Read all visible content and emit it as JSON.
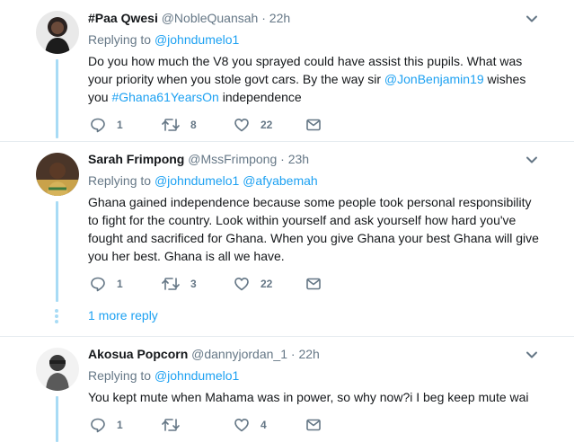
{
  "tweets": [
    {
      "name": "#Paa Qwesi",
      "handle": "@NobleQuansah",
      "dot": "·",
      "time": "22h",
      "replying_label": "Replying to",
      "replying_to": [
        "@johndumelo1"
      ],
      "body": [
        {
          "t": "Do you how much the V8 you sprayed could have assist this pupils. What was your priority when you stole govt cars. By the way sir "
        },
        {
          "t": "@JonBenjamin19",
          "link": true
        },
        {
          "t": " wishes you "
        },
        {
          "t": "#Ghana61YearsOn",
          "link": true
        },
        {
          "t": " independence"
        }
      ],
      "replies": "1",
      "retweets": "8",
      "likes": "22"
    },
    {
      "name": "Sarah Frimpong",
      "handle": "@MssFrimpong",
      "dot": "·",
      "time": "23h",
      "replying_label": "Replying to",
      "replying_to": [
        "@johndumelo1",
        "@afyabemah"
      ],
      "body": [
        {
          "t": "Ghana gained independence because some people took personal responsibility to fight for the country. Look within yourself and ask yourself how hard you've fought and sacrificed for Ghana. When you give Ghana your best Ghana will give you her best. Ghana is all we have."
        }
      ],
      "replies": "1",
      "retweets": "3",
      "likes": "22"
    },
    {
      "name": "Akosua Popcorn",
      "handle": "@dannyjordan_1",
      "dot": "·",
      "time": "22h",
      "replying_label": "Replying to",
      "replying_to": [
        "@johndumelo1"
      ],
      "body": [
        {
          "t": "You kept mute when Mahama was in power, so why now?i I beg keep mute wai"
        }
      ],
      "replies": "1",
      "retweets": "",
      "likes": "4"
    }
  ],
  "more_replies_label": "1 more reply",
  "icons": {
    "reply": "reply-icon",
    "retweet": "retweet-icon",
    "like": "heart-icon",
    "dm": "envelope-icon",
    "caret": "chevron-down-icon"
  },
  "colors": {
    "link": "#1da1f2",
    "muted": "#657786",
    "thread_line": "#a8dbf5",
    "divider": "#e6ecf0"
  }
}
